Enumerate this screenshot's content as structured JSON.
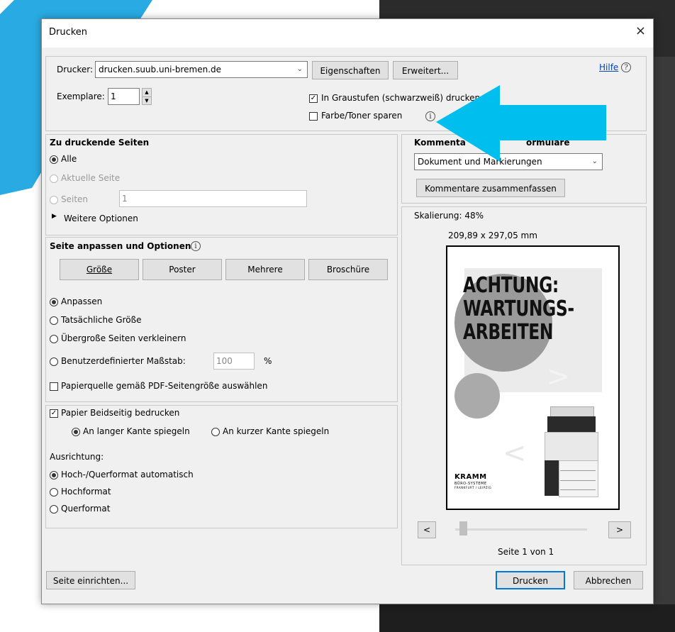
{
  "dialog": {
    "title": "Drucken",
    "close_glyph": "×",
    "printer_label": "Drucker:",
    "printer_value": "drucken.suub.uni-bremen.de",
    "properties_button": "Eigenschaften",
    "advanced_button": "Erweitert...",
    "help_link": "Hilfe",
    "copies_label": "Exemplare:",
    "copies_value": "1",
    "grayscale_label": "In Graustufen (schwarzweiß) drucken",
    "save_toner_label": "Farbe/Toner sparen",
    "pages_section": {
      "title": "Zu druckende Seiten",
      "all": "Alle",
      "current": "Aktuelle Seite",
      "pages": "Seiten",
      "pages_value": "1",
      "more_options": "Weitere Optionen"
    },
    "fit_section": {
      "title": "Seite anpassen und Optionen",
      "tabs": [
        "Größe",
        "Poster",
        "Mehrere",
        "Broschüre"
      ],
      "fit": "Anpassen",
      "actual_size": "Tatsächliche Größe",
      "shrink_oversize": "Übergroße Seiten verkleinern",
      "custom_scale": "Benutzerdefinierter Maßstab:",
      "custom_scale_value": "100",
      "percent": "%",
      "paper_source": "Papierquelle gemäß PDF-Seitengröße auswählen"
    },
    "duplex_section": {
      "duplex": "Papier Beidseitig bedrucken",
      "long_edge": "An langer Kante spiegeln",
      "short_edge": "An kurzer Kante spiegeln",
      "orientation_label": "Ausrichtung:",
      "auto": "Hoch-/Querformat automatisch",
      "portrait": "Hochformat",
      "landscape": "Querformat"
    },
    "comments_section": {
      "title_visible_left": "Kommenta",
      "title_visible_right": "ormulare",
      "dropdown_value": "Dokument und Markierungen",
      "summarize_button": "Kommentare zusammenfassen"
    },
    "preview": {
      "scaling": "Skalierung:  48%",
      "dimensions": "209,89 x 297,05 mm",
      "headline_1": "ACHTUNG:",
      "headline_2": "WARTUNGS-",
      "headline_3": "ARBEITEN",
      "logo_text": "KRAMM",
      "logo_sub": "BÜRO-SYSTEME",
      "logo_sub2": "FRANKFURT / LEIPZIG",
      "prev_button": "<",
      "next_button": ">",
      "page_indicator": "Seite 1 von 1"
    },
    "footer": {
      "page_setup": "Seite einrichten...",
      "print": "Drucken",
      "cancel": "Abbrechen"
    }
  },
  "colors": {
    "accent_blue": "#29aae2",
    "arrow_cyan": "#00bfef"
  }
}
